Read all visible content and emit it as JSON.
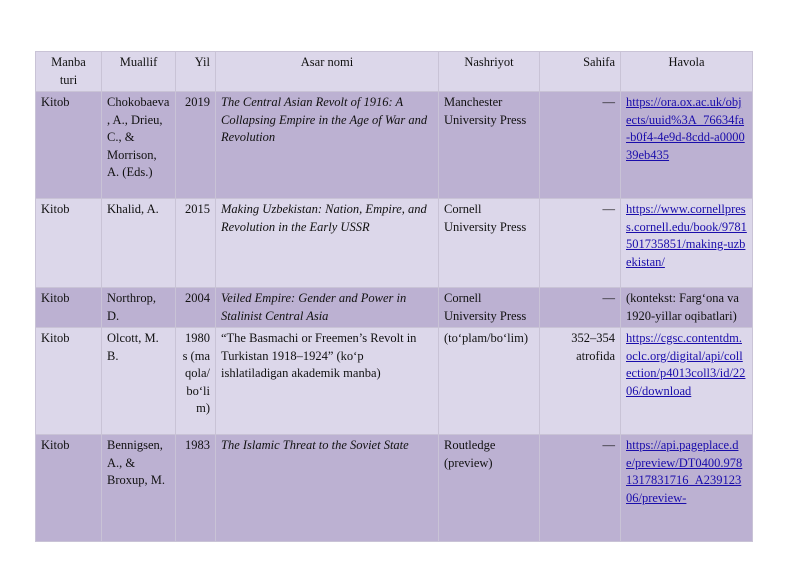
{
  "table": {
    "headers": {
      "type": "Manba turi",
      "author": "Muallif",
      "year": "Yil",
      "title": "Asar nomi",
      "publisher": "Nashriyot",
      "pages": "Sahifa",
      "link": "Havola"
    },
    "rows": [
      {
        "type": "Kitob",
        "author": "Chokobaeva, A., Drieu, C., & Morrison, A. (Eds.)",
        "year": "2019",
        "title": "The Central Asian Revolt of 1916: A Collapsing Empire in the Age of War and Revolution",
        "publisher": "Manchester University Press",
        "pages": "—",
        "link": "https://ora.ox.ac.uk/objects/uuid%3A_76634fa-b0f4-4e9d-8cdd-a000039eb435"
      },
      {
        "type": "Kitob",
        "author": "Khalid, A.",
        "year": "2015",
        "title": "Making Uzbekistan: Nation, Empire, and Revolution in the Early USSR",
        "publisher": "Cornell University Press",
        "pages": "—",
        "link": "https://www.cornellpress.cornell.edu/book/9781501735851/making-uzbekistan/"
      },
      {
        "type": "Kitob",
        "author": "Northrop, D.",
        "year": "2004",
        "title": "Veiled Empire: Gender and Power in Stalinist Central Asia",
        "publisher": "Cornell University Press",
        "pages": "—",
        "link": "(kontekst: Farg‘ona va 1920-yillar oqibatlari)"
      },
      {
        "type": "Kitob",
        "author": "Olcott, M. B.",
        "year": "1980s (maqola/bo‘lim)",
        "title": "“The Basmachi or Freemen’s Revolt in Turkistan 1918–1924” (ko‘p ishlatiladigan akademik manba)",
        "publisher": "(to‘plam/bo‘lim)",
        "pages": "352–354 atrofida",
        "link": "https://cgsc.contentdm.oclc.org/digital/api/collection/p4013coll3/id/2206/download"
      },
      {
        "type": "Kitob",
        "author": "Bennigsen, A., & Broxup, M.",
        "year": "1983",
        "title": "The Islamic Threat to the Soviet State",
        "publisher": "Routledge (preview)",
        "pages": "—",
        "link": "https://api.pageplace.de/preview/DT0400.9781317831716_A23912306/preview-"
      }
    ]
  },
  "colors": {
    "header_bg": "#dcd7ea",
    "row_dark": "#bcb1d2",
    "row_light": "#dcd7ea",
    "link": "#1a0dab"
  }
}
